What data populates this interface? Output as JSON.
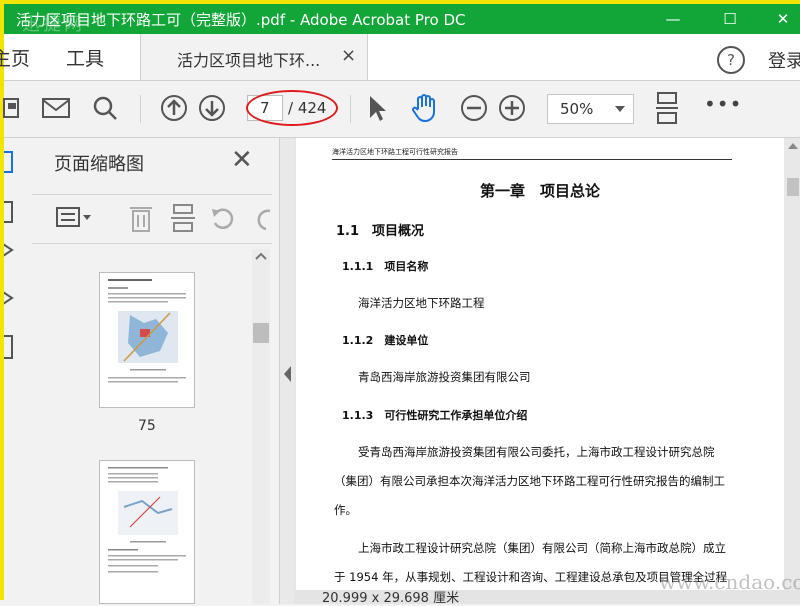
{
  "window": {
    "title": "活力区项目地下环路工可（完整版）.pdf - Adobe Acrobat Pro DC",
    "watermark": "迅捷网",
    "minimize": "—",
    "maximize": "☐",
    "close": "✕"
  },
  "tabs": {
    "home": "主页",
    "tools": "工具",
    "document": "活力区项目地下环...",
    "close": "×",
    "help": "?",
    "login": "登录"
  },
  "toolbar": {
    "current_page": "7",
    "total_pages": "/ 424",
    "zoom": "50%",
    "more": "•••",
    "icons": [
      "save-icon",
      "mail-icon",
      "search-icon",
      "page-up-icon",
      "page-down-icon",
      "select-arrow-icon",
      "hand-icon",
      "zoom-out-icon",
      "zoom-in-icon",
      "fit-page-icon"
    ]
  },
  "panel": {
    "title": "页面缩略图",
    "close": "✕",
    "thumbnails": [
      {
        "label": "75"
      },
      {
        "label": ""
      }
    ]
  },
  "document": {
    "running_head": "海洋活力区地下环路工程可行性研究报告",
    "chapter": "第一章　项目总论",
    "s1_1": "1.1　项目概况",
    "s1_1_1": "1.1.1　项目名称",
    "s1_1_1_body": "海洋活力区地下环路工程",
    "s1_1_2": "1.1.2　建设单位",
    "s1_1_2_body": "青岛西海岸旅游投资集团有限公司",
    "s1_1_3": "1.1.3　可行性研究工作承担单位介绍",
    "p1_l1": "受青岛西海岸旅游投资集团有限公司委托，上海市政工程设计研究总院",
    "p1_l2": "（集团）有限公司承担本次海洋活力区地下环路工程可行性研究报告的编制工",
    "p1_l3": "作。",
    "p2_l1": "上海市政工程设计研究总院（集团）有限公司（简称上海市政总院）成立",
    "p2_l2": "于 1954 年，从事规划、工程设计和咨询、工程建设总承包及项目管理全过程"
  },
  "status": {
    "page_size": "20.999 x 29.698 厘米"
  },
  "watermark_bottom": "www.cndao.com",
  "colors": {
    "titlebar": "#12a537",
    "frame": "#f2e600",
    "highlight_oval": "#e01b1b",
    "hand_tool": "#1a73d9"
  }
}
